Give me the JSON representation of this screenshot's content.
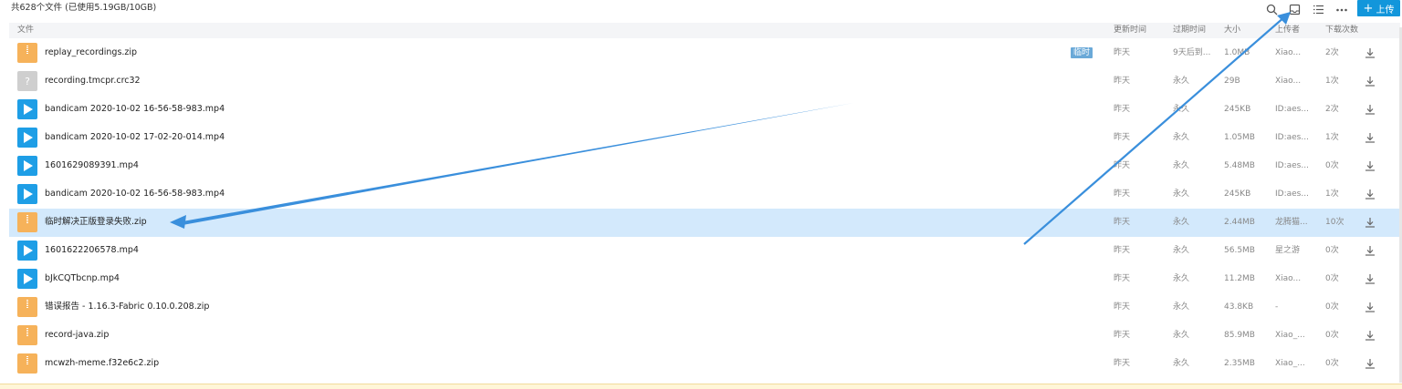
{
  "summary": "共628个文件 (已使用5.19GB/10GB)",
  "toolbar": {
    "upload_label": "上传",
    "search_icon": "search-icon",
    "inbox_icon": "inbox-icon",
    "list_icon": "list-view-icon",
    "more_icon": "more-icon"
  },
  "columns": {
    "file": "文件",
    "updated": "更新时间",
    "expires": "过期时间",
    "size": "大小",
    "uploader": "上传者",
    "downloads": "下载次数"
  },
  "files": [
    {
      "name": "replay_recordings.zip",
      "icon": "zip-icon",
      "tag": "临时",
      "updated": "昨天",
      "expires": "9天后到...",
      "size": "1.0MB",
      "uploader": "Xiao...",
      "downloads": "2次"
    },
    {
      "name": "recording.tmcpr.crc32",
      "icon": "unknown-file-icon",
      "tag": "",
      "updated": "昨天",
      "expires": "永久",
      "size": "29B",
      "uploader": "Xiao...",
      "downloads": "1次"
    },
    {
      "name": "bandicam 2020-10-02 16-56-58-983.mp4",
      "icon": "video-icon",
      "tag": "",
      "updated": "昨天",
      "expires": "永久",
      "size": "245KB",
      "uploader": "ID:aes...",
      "downloads": "2次"
    },
    {
      "name": "bandicam 2020-10-02 17-02-20-014.mp4",
      "icon": "video-icon",
      "tag": "",
      "updated": "昨天",
      "expires": "永久",
      "size": "1.05MB",
      "uploader": "ID:aes...",
      "downloads": "1次"
    },
    {
      "name": "1601629089391.mp4",
      "icon": "video-icon",
      "tag": "",
      "updated": "昨天",
      "expires": "永久",
      "size": "5.48MB",
      "uploader": "ID:aes...",
      "downloads": "0次"
    },
    {
      "name": "bandicam 2020-10-02 16-56-58-983.mp4",
      "icon": "video-icon",
      "tag": "",
      "updated": "昨天",
      "expires": "永久",
      "size": "245KB",
      "uploader": "ID:aes...",
      "downloads": "1次"
    },
    {
      "name": "临时解决正版登录失败.zip",
      "icon": "zip-icon",
      "tag": "",
      "updated": "昨天",
      "expires": "永久",
      "size": "2.44MB",
      "uploader": "龙腾猫...",
      "downloads": "10次",
      "selected": true
    },
    {
      "name": "1601622206578.mp4",
      "icon": "video-icon",
      "tag": "",
      "updated": "昨天",
      "expires": "永久",
      "size": "56.5MB",
      "uploader": "星之游",
      "downloads": "0次"
    },
    {
      "name": "bJkCQTbcnp.mp4",
      "icon": "video-icon",
      "tag": "",
      "updated": "昨天",
      "expires": "永久",
      "size": "11.2MB",
      "uploader": "Xiao...",
      "downloads": "0次"
    },
    {
      "name": "错误报告 - 1.16.3-Fabric 0.10.0.208.zip",
      "icon": "zip-icon",
      "tag": "",
      "updated": "昨天",
      "expires": "永久",
      "size": "43.8KB",
      "uploader": "-",
      "downloads": "0次"
    },
    {
      "name": "record-java.zip",
      "icon": "zip-icon",
      "tag": "",
      "updated": "昨天",
      "expires": "永久",
      "size": "85.9MB",
      "uploader": "Xiao_...",
      "downloads": "0次"
    },
    {
      "name": "mcwzh-meme.f32e6c2.zip",
      "icon": "zip-icon",
      "tag": "",
      "updated": "昨天",
      "expires": "永久",
      "size": "2.35MB",
      "uploader": "Xiao_...",
      "downloads": "0次"
    }
  ],
  "colors": {
    "accent": "#1296db",
    "selected_row": "#d3e9fc",
    "zip_icon": "#f6b25a",
    "video_icon": "#1e9ee6",
    "annotation_arrow": "#3a8fdc"
  }
}
